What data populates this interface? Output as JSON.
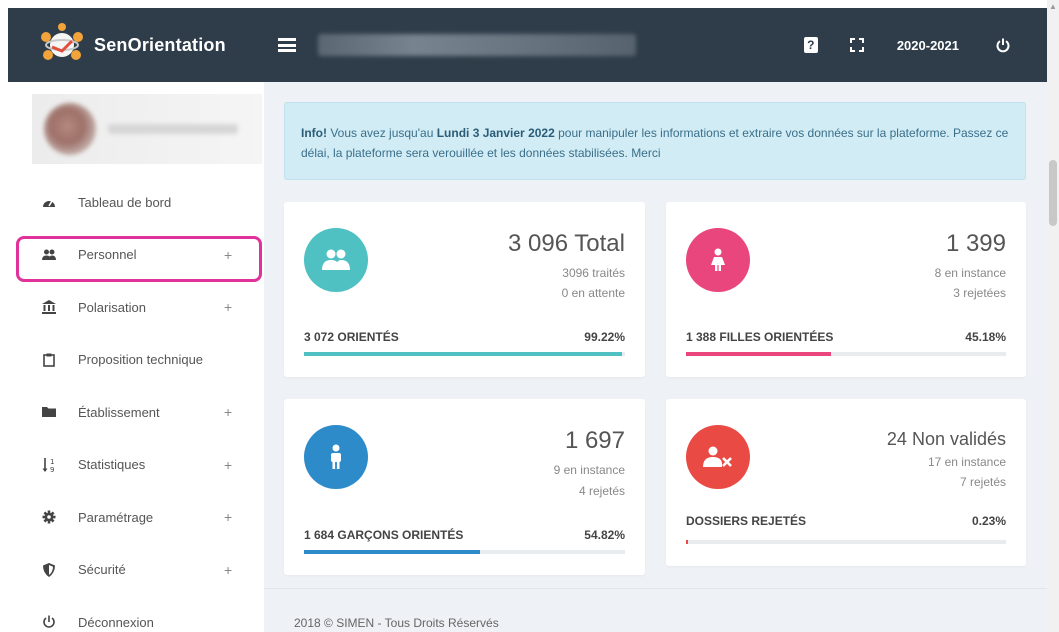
{
  "brand": {
    "name": "SenOrientation"
  },
  "topbar": {
    "year": "2020-2021"
  },
  "sidebar": {
    "items": [
      {
        "label": "Tableau de bord",
        "icon": "dashboard-icon",
        "plus": ""
      },
      {
        "label": "Personnel",
        "icon": "users-icon",
        "plus": "+"
      },
      {
        "label": "Polarisation",
        "icon": "bank-icon",
        "plus": "+"
      },
      {
        "label": "Proposition technique",
        "icon": "clipboard-icon",
        "plus": ""
      },
      {
        "label": "Établissement",
        "icon": "folder-icon",
        "plus": "+"
      },
      {
        "label": "Statistiques",
        "icon": "sort-numeric-icon",
        "plus": "+"
      },
      {
        "label": "Paramétrage",
        "icon": "gear-icon",
        "plus": "+"
      },
      {
        "label": "Sécurité",
        "icon": "shield-icon",
        "plus": "+"
      },
      {
        "label": "Déconnexion",
        "icon": "power-icon",
        "plus": ""
      }
    ]
  },
  "alert": {
    "prefix": "Info!",
    "text1": " Vous avez jusqu'au ",
    "date": "Lundi 3 Janvier 2022",
    "text2": " pour manipuler les informations et extraire vos données sur la plateforme. Passez ce délai, la plateforme sera verouillée et les données stabilisées. Merci"
  },
  "cards": {
    "total": {
      "value": "3 096 Total",
      "line1": "3096 traités",
      "line2": "0 en attente",
      "label": "3 072 ORIENTÉS",
      "percent": "99.22%",
      "progress": 99.22,
      "color": "#4fc1c2"
    },
    "filles": {
      "value": "1 399",
      "line1": "8 en instance",
      "line2": "3 rejetées",
      "label": "1 388 FILLES ORIENTÉES",
      "percent": "45.18%",
      "progress": 45.18,
      "color": "#e8467c"
    },
    "garcons": {
      "value": "1 697",
      "line1": "9 en instance",
      "line2": "4 rejetés",
      "label": "1 684 GARÇONS ORIENTÉS",
      "percent": "54.82%",
      "progress": 54.82,
      "color": "#2d8bc9"
    },
    "rejetes": {
      "value": "24 Non validés",
      "line1": "17 en instance",
      "line2": "7 rejetés",
      "label": "DOSSIERS REJETÉS",
      "percent": "0.23%",
      "progress": 0.23,
      "color": "#ea4a44"
    }
  },
  "footer": {
    "text": "2018 © SIMEN - Tous Droits Réservés"
  }
}
